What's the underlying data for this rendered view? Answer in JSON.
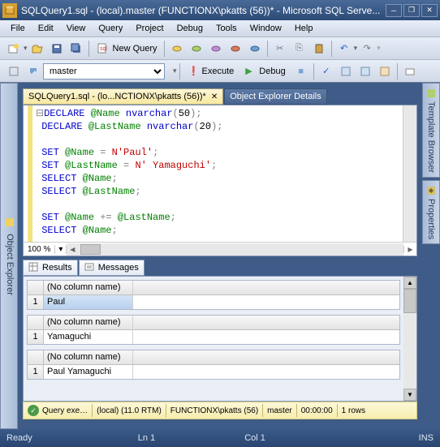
{
  "window": {
    "title": "SQLQuery1.sql - (local).master (FUNCTIONX\\pkatts (56))* - Microsoft SQL Serve..."
  },
  "menu": [
    "File",
    "Edit",
    "View",
    "Query",
    "Project",
    "Debug",
    "Tools",
    "Window",
    "Help"
  ],
  "toolbar1": {
    "new_query": "New Query"
  },
  "toolbar2": {
    "database": "master",
    "execute": "Execute",
    "debug": "Debug"
  },
  "sidebars": {
    "left": "Object Explorer",
    "right1": "Template Browser",
    "right2": "Properties"
  },
  "doc_tabs": {
    "active": "SQLQuery1.sql - (lo...NCTIONX\\pkatts (56))*",
    "inactive": "Object Explorer Details"
  },
  "editor": {
    "zoom": "100 %",
    "code": {
      "l1": {
        "kw": "DECLARE",
        "var": "@Name",
        "dt": "nvarchar",
        "num": "50"
      },
      "l2": {
        "kw": "DECLARE",
        "var": "@LastName",
        "dt": "nvarchar",
        "num": "20"
      },
      "l3": {
        "kw": "SET",
        "var": "@Name",
        "str": "N'Paul'"
      },
      "l4": {
        "kw": "SET",
        "var": "@LastName",
        "str": "N' Yamaguchi'"
      },
      "l5": {
        "kw": "SELECT",
        "var": "@Name"
      },
      "l6": {
        "kw": "SELECT",
        "var": "@LastName"
      },
      "l7": {
        "kw": "SET",
        "var": "@Name",
        "op": "+=",
        "var2": "@LastName"
      },
      "l8": {
        "kw": "SELECT",
        "var": "@Name"
      }
    }
  },
  "results_tabs": [
    "Results",
    "Messages"
  ],
  "results": [
    {
      "header": "(No column name)",
      "rownum": "1",
      "value": "Paul"
    },
    {
      "header": "(No column name)",
      "rownum": "1",
      "value": " Yamaguchi"
    },
    {
      "header": "(No column name)",
      "rownum": "1",
      "value": "Paul Yamaguchi"
    }
  ],
  "status_query": {
    "msg": "Query exe…",
    "server": "(local) (11.0 RTM)",
    "user": "FUNCTIONX\\pkatts (56)",
    "db": "master",
    "time": "00:00:00",
    "rows": "1 rows"
  },
  "status_bar": {
    "ready": "Ready",
    "ln": "Ln 1",
    "col": "Col 1",
    "mode": "INS"
  }
}
